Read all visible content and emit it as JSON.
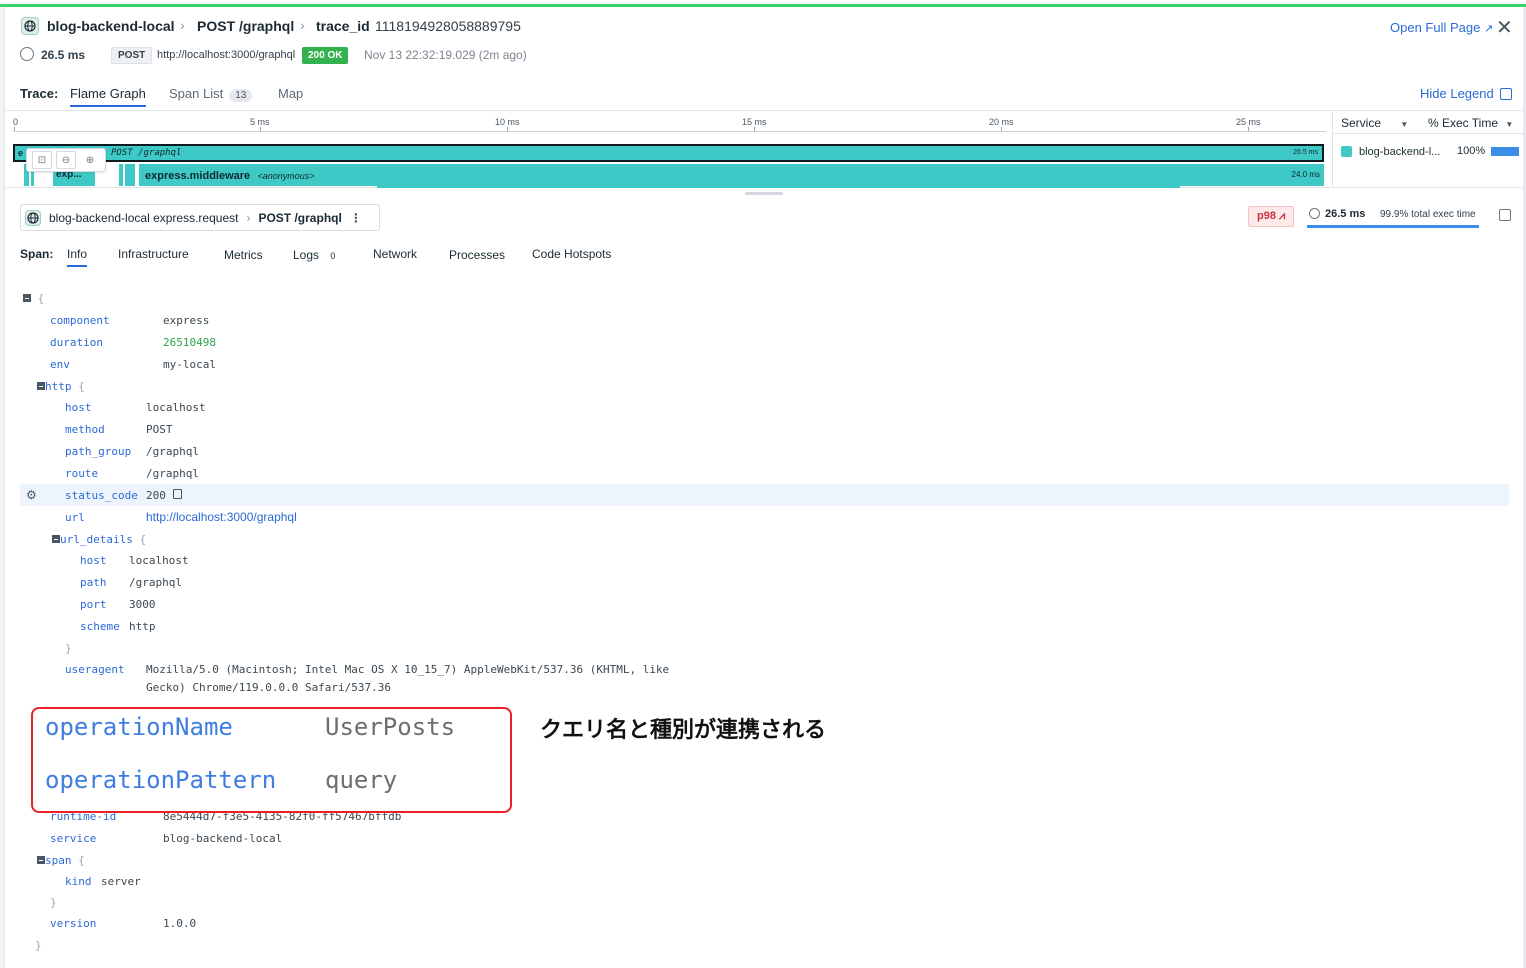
{
  "header": {
    "service": "blog-backend-local",
    "resource": "POST /graphql",
    "trace_id_label": "trace_id",
    "trace_id": "1118194928058889795",
    "open_full_page": "Open Full Page",
    "duration": "26.5 ms",
    "method": "POST",
    "url": "http://localhost:3000/graphql",
    "status": "200 OK",
    "timestamp": "Nov 13 22:32:19.029 (2m ago)"
  },
  "trace_tabs": {
    "label": "Trace:",
    "tabs": [
      {
        "label": "Flame Graph"
      },
      {
        "label": "Span List",
        "count": "13"
      },
      {
        "label": "Map"
      }
    ],
    "hide_legend": "Hide Legend"
  },
  "flame": {
    "ticks": [
      "0",
      "5 ms",
      "10 ms",
      "15 ms",
      "20 ms",
      "25 ms"
    ],
    "root_label": "POST /graphql",
    "root_prefix": "e",
    "root_time": "26.5 ms",
    "child_short": "exp...",
    "child_name": "express.middleware",
    "child_sub": "<anonymous>",
    "child_time": "24.0 ms"
  },
  "legend": {
    "service_header": "Service",
    "exec_header": "% Exec Time",
    "rows": [
      {
        "name": "blog-backend-l...",
        "pct": "100%",
        "color": "#3ec9c6",
        "bar_color": "#3a8ee6"
      }
    ]
  },
  "span": {
    "service": "blog-backend-local",
    "operation": "express.request",
    "resource": "POST /graphql",
    "p98": "p98",
    "duration": "26.5 ms",
    "exec_time": "99.9% total exec time",
    "tabs_label": "Span:",
    "tabs": [
      {
        "label": "Info"
      },
      {
        "label": "Infrastructure"
      },
      {
        "label": "Metrics"
      },
      {
        "label": "Logs",
        "count": "0"
      },
      {
        "label": "Network"
      },
      {
        "label": "Processes"
      },
      {
        "label": "Code Hotspots"
      }
    ]
  },
  "json": {
    "open": "{",
    "close": "}",
    "component_k": "component",
    "component_v": "express",
    "duration_k": "duration",
    "duration_v": "26510498",
    "env_k": "env",
    "env_v": "my-local",
    "http_k": "http",
    "host_k": "host",
    "host_v": "localhost",
    "method_k": "method",
    "method_v": "POST",
    "path_group_k": "path_group",
    "path_group_v": "/graphql",
    "route_k": "route",
    "route_v": "/graphql",
    "status_code_k": "status_code",
    "status_code_v": "200",
    "url_k": "url",
    "url_v": "http://localhost:3000/graphql",
    "url_details_k": "url_details",
    "ud_host_k": "host",
    "ud_host_v": "localhost",
    "ud_path_k": "path",
    "ud_path_v": "/graphql",
    "ud_port_k": "port",
    "ud_port_v": "3000",
    "ud_scheme_k": "scheme",
    "ud_scheme_v": "http",
    "useragent_k": "useragent",
    "useragent_v1": "Mozilla/5.0 (Macintosh; Intel Mac OS X 10_15_7) AppleWebKit/537.36 (KHTML, like",
    "useragent_v2": "Gecko) Chrome/119.0.0.0 Safari/537.36",
    "runtime_id_k": "runtime-id",
    "runtime_id_v": "8e5444d7-f3e5-4135-82f0-ff57467bffdb",
    "service_k": "service",
    "service_v": "blog-backend-local",
    "span_k": "span",
    "kind_k": "kind",
    "kind_v": "server",
    "version_k": "version",
    "version_v": "1.0.0"
  },
  "callout": {
    "op_name_k": "operationName",
    "op_name_v": "UserPosts",
    "op_pattern_k": "operationPattern",
    "op_pattern_v": "query",
    "note": "クエリ名と種別が連携される"
  }
}
